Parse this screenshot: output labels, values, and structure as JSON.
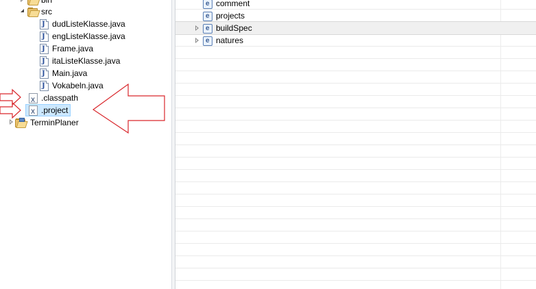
{
  "explorer": {
    "items": [
      {
        "label": "bin",
        "kind": "folder"
      },
      {
        "label": "src",
        "kind": "folder"
      },
      {
        "label": "dudListeKlasse.java",
        "kind": "java"
      },
      {
        "label": "engListeKlasse.java",
        "kind": "java"
      },
      {
        "label": "Frame.java",
        "kind": "java"
      },
      {
        "label": "itaListeKlasse.java",
        "kind": "java"
      },
      {
        "label": "Main.java",
        "kind": "java"
      },
      {
        "label": "Vokabeln.java",
        "kind": "java"
      },
      {
        "label": ".classpath",
        "kind": "xml"
      },
      {
        "label": ".project",
        "kind": "xml",
        "selected": true
      },
      {
        "label": "TerminPlaner",
        "kind": "project"
      }
    ]
  },
  "outline": {
    "elements": [
      {
        "label": "comment",
        "expandable": false
      },
      {
        "label": "projects",
        "expandable": false
      },
      {
        "label": "buildSpec",
        "expandable": true,
        "highlighted": true
      },
      {
        "label": "natures",
        "expandable": true
      }
    ]
  },
  "colors": {
    "selection_bg": "#cce8ff",
    "selection_border": "#99d1ff",
    "annotation_arrow": "#d9262b"
  }
}
